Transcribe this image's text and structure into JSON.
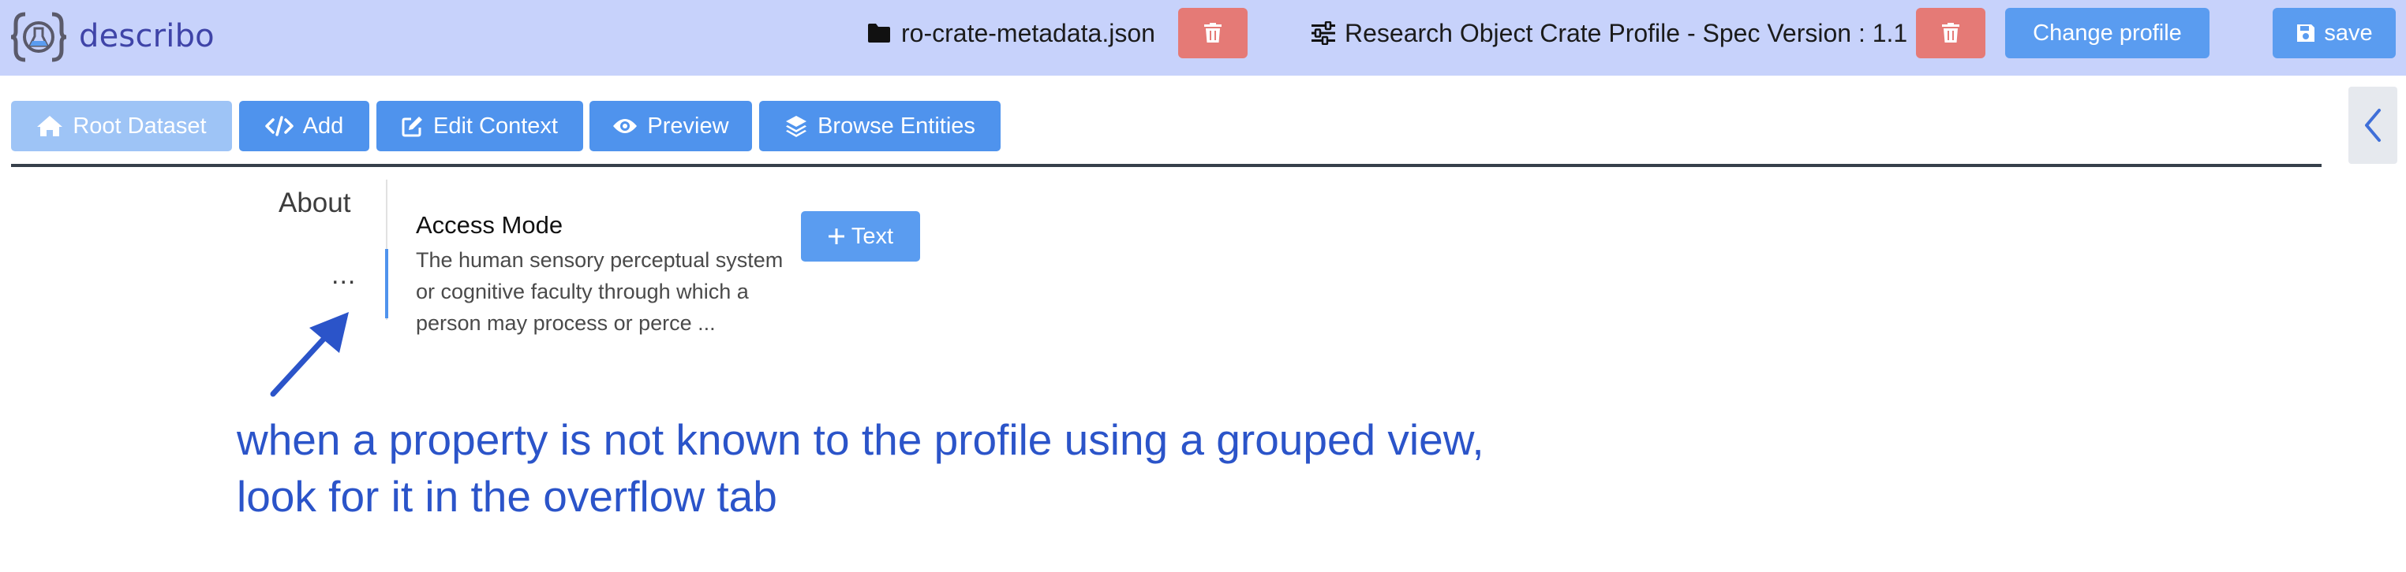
{
  "header": {
    "brand": "describo",
    "file_name": "ro-crate-metadata.json",
    "profile_name": "Research Object Crate Profile - Spec Version : 1.1",
    "change_profile_label": "Change profile",
    "save_label": "save"
  },
  "toolbar": {
    "root_dataset_label": "Root Dataset",
    "add_label": "Add",
    "edit_context_label": "Edit Context",
    "preview_label": "Preview",
    "browse_entities_label": "Browse Entities"
  },
  "tabs": {
    "about_label": "About",
    "overflow_label": "..."
  },
  "property": {
    "title": "Access Mode",
    "description": "The human sensory perceptual system or cognitive faculty through which a person may process or perce ...",
    "add_text_label": "Text"
  },
  "annotation": {
    "line1": "when a property is not known to the profile using a grouped view,",
    "line2": "look for it in the overflow tab"
  },
  "colors": {
    "header_bg": "#c7d2fb",
    "primary": "#4f93ed",
    "danger": "#e57a76",
    "annotation": "#2b54c9"
  }
}
